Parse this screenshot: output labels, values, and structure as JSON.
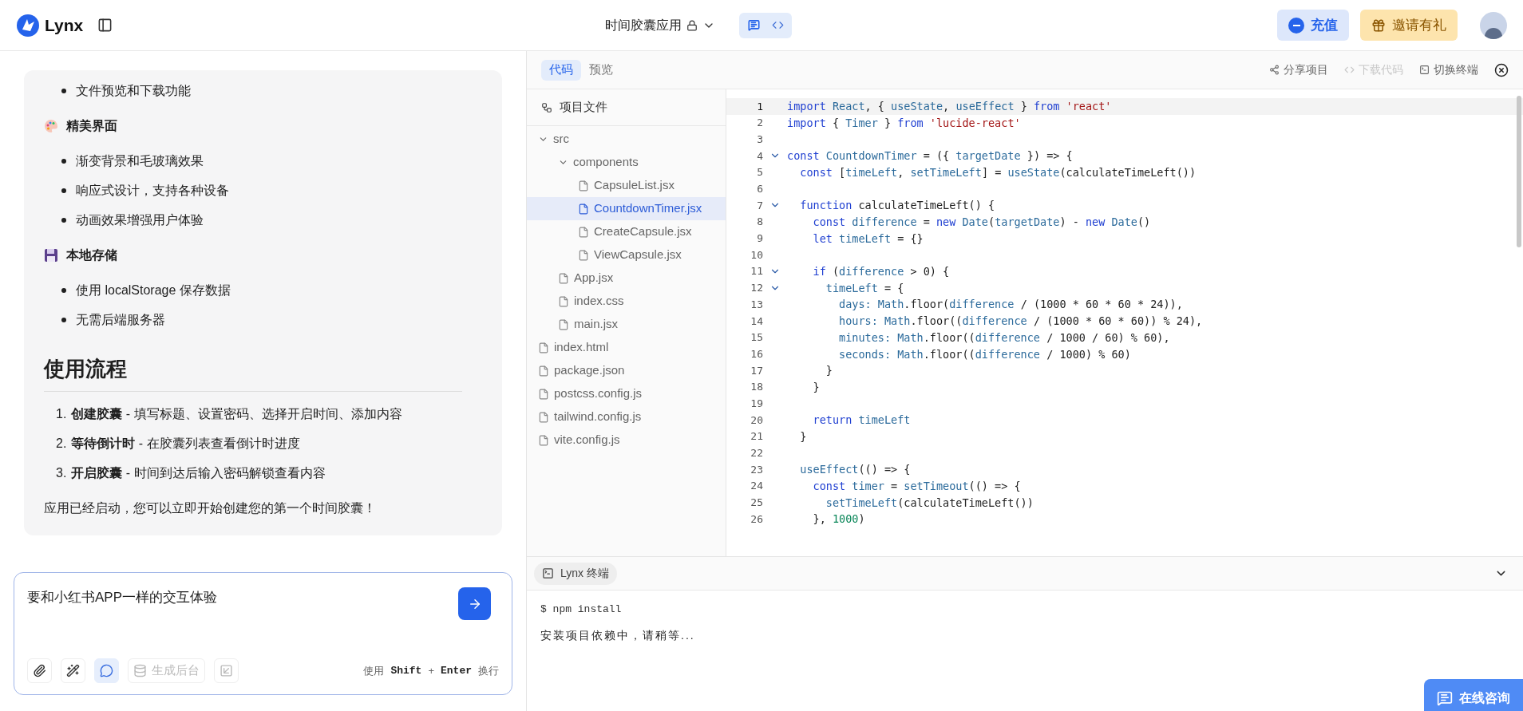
{
  "header": {
    "logo": "Lynx",
    "project_title": "时间胶囊应用",
    "view_modes": [
      {
        "selected": true
      },
      {
        "selected": false
      }
    ],
    "recharge": "充值",
    "invite": "邀请有礼"
  },
  "chat": [
    {
      "kind": "bullets",
      "items": [
        "文件预览和下载功能"
      ]
    },
    {
      "kind": "subheading",
      "text": "精美界面"
    },
    {
      "kind": "bullets",
      "items": [
        "渐变背景和毛玻璃效果",
        "响应式设计，支持各种设备",
        "动画效果增强用户体验"
      ]
    },
    {
      "kind": "subheading",
      "text": "本地存储"
    },
    {
      "kind": "bullets",
      "items": [
        "使用 localStorage 保存数据",
        "无需后端服务器"
      ]
    },
    {
      "kind": "heading",
      "text": "使用流程"
    },
    {
      "kind": "ordered",
      "items": [
        {
          "number": "1.",
          "text": "**创建胶囊** - 填写标题、设置密码、选择开启时间、添加内容"
        },
        {
          "number": "2.",
          "text": "**等待倒计时** - 在胶囊列表查看倒计时进度"
        },
        {
          "number": "3.",
          "text": "**开启胶囊** - 时间到达后输入密码解锁查看内容"
        }
      ]
    },
    {
      "kind": "paragraph",
      "text": "应用已经启动，您可以立即开始创建您的第一个时间胶囊！"
    }
  ],
  "composer": {
    "value": "要和小红书APP一样的交互体验",
    "tools": [
      {
        "selected": false,
        "disabled": false
      },
      {
        "selected": false,
        "disabled": false
      },
      {
        "selected": true,
        "disabled": false
      },
      {
        "label": "生成后台",
        "selected": false,
        "disabled": true
      },
      {
        "selected": false,
        "disabled": true
      }
    ],
    "hint": [
      "使用",
      "Shift",
      "+",
      "Enter",
      "换行"
    ]
  },
  "editor_tabs": [
    {
      "label": "代码",
      "selected": true
    },
    {
      "label": "预览",
      "selected": false
    }
  ],
  "editor_actions": [
    {
      "label": "分享项目",
      "disabled": false
    },
    {
      "label": "下载代码",
      "disabled": true
    },
    {
      "label": "切换终端",
      "disabled": false
    }
  ],
  "file_tree": {
    "title": "项目文件",
    "items": [
      {
        "name": "src",
        "kind": "folder",
        "expanded": true,
        "selected": false,
        "children": [
          {
            "name": "components",
            "kind": "folder",
            "expanded": true,
            "selected": false,
            "children": [
              {
                "name": "CapsuleList.jsx",
                "kind": "file",
                "selected": false
              },
              {
                "name": "CountdownTimer.jsx",
                "kind": "file",
                "selected": true
              },
              {
                "name": "CreateCapsule.jsx",
                "kind": "file",
                "selected": false
              },
              {
                "name": "ViewCapsule.jsx",
                "kind": "file",
                "selected": false
              }
            ]
          },
          {
            "name": "App.jsx",
            "kind": "file",
            "selected": false
          },
          {
            "name": "index.css",
            "kind": "file",
            "selected": false
          },
          {
            "name": "main.jsx",
            "kind": "file",
            "selected": false
          }
        ]
      },
      {
        "name": "index.html",
        "kind": "file",
        "selected": false
      },
      {
        "name": "package.json",
        "kind": "file",
        "selected": false
      },
      {
        "name": "postcss.config.js",
        "kind": "file",
        "selected": false
      },
      {
        "name": "tailwind.config.js",
        "kind": "file",
        "selected": false
      },
      {
        "name": "vite.config.js",
        "kind": "file",
        "selected": false
      }
    ]
  },
  "code": [
    {
      "n": "1",
      "fold": false,
      "current": true,
      "tokens": [
        {
          "kind": "kw",
          "text": "import"
        },
        {
          "kind": "id",
          "text": " React"
        },
        {
          "kind": "p",
          "text": ", { "
        },
        {
          "kind": "id",
          "text": "useState"
        },
        {
          "kind": "p",
          "text": ", "
        },
        {
          "kind": "id",
          "text": "useEffect"
        },
        {
          "kind": "p",
          "text": " } "
        },
        {
          "kind": "kw",
          "text": "from"
        },
        {
          "kind": "str",
          "text": " 'react'"
        }
      ]
    },
    {
      "n": "2",
      "fold": false,
      "current": false,
      "tokens": [
        {
          "kind": "kw",
          "text": "import"
        },
        {
          "kind": "p",
          "text": " { "
        },
        {
          "kind": "id",
          "text": "Timer"
        },
        {
          "kind": "p",
          "text": " } "
        },
        {
          "kind": "kw",
          "text": "from"
        },
        {
          "kind": "str",
          "text": " 'lucide-react'"
        }
      ]
    },
    {
      "n": "3",
      "fold": false,
      "current": false
    },
    {
      "n": "4",
      "fold": true,
      "current": false,
      "tokens": [
        {
          "kind": "kw",
          "text": "const"
        },
        {
          "kind": "id",
          "text": " CountdownTimer"
        },
        {
          "kind": "p",
          "text": " = ({ "
        },
        {
          "kind": "id",
          "text": "targetDate"
        },
        {
          "kind": "p",
          "text": " }) => {"
        }
      ]
    },
    {
      "n": "5",
      "fold": false,
      "current": false,
      "tokens": [
        {
          "kind": "kw",
          "text": "  const"
        },
        {
          "kind": "p",
          "text": " ["
        },
        {
          "kind": "id",
          "text": "timeLeft"
        },
        {
          "kind": "p",
          "text": ", "
        },
        {
          "kind": "id",
          "text": "setTimeLeft"
        },
        {
          "kind": "p",
          "text": "] = "
        },
        {
          "kind": "id",
          "text": "useState"
        },
        {
          "kind": "p",
          "text": "(calculateTimeLeft())"
        }
      ]
    },
    {
      "n": "6",
      "fold": false,
      "current": false
    },
    {
      "n": "7",
      "fold": true,
      "current": false,
      "tokens": [
        {
          "kind": "kw",
          "text": "  function"
        },
        {
          "kind": "p",
          "text": " calculateTimeLeft() {"
        }
      ]
    },
    {
      "n": "8",
      "fold": false,
      "current": false,
      "tokens": [
        {
          "kind": "kw",
          "text": "    const"
        },
        {
          "kind": "id",
          "text": " difference"
        },
        {
          "kind": "p",
          "text": " = "
        },
        {
          "kind": "kw",
          "text": "new"
        },
        {
          "kind": "id",
          "text": " Date"
        },
        {
          "kind": "p",
          "text": "("
        },
        {
          "kind": "id",
          "text": "targetDate"
        },
        {
          "kind": "p",
          "text": ") - "
        },
        {
          "kind": "kw",
          "text": "new"
        },
        {
          "kind": "id",
          "text": " Date"
        },
        {
          "kind": "p",
          "text": "()"
        }
      ]
    },
    {
      "n": "9",
      "fold": false,
      "current": false,
      "tokens": [
        {
          "kind": "kw",
          "text": "    let"
        },
        {
          "kind": "id",
          "text": " timeLeft"
        },
        {
          "kind": "p",
          "text": " = {}"
        }
      ]
    },
    {
      "n": "10",
      "fold": false,
      "current": false
    },
    {
      "n": "11",
      "fold": true,
      "current": false,
      "tokens": [
        {
          "kind": "kw",
          "text": "    if"
        },
        {
          "kind": "p",
          "text": " ("
        },
        {
          "kind": "id",
          "text": "difference"
        },
        {
          "kind": "p",
          "text": " > 0) {"
        }
      ]
    },
    {
      "n": "12",
      "fold": true,
      "current": false,
      "tokens": [
        {
          "kind": "id",
          "text": "      timeLeft"
        },
        {
          "kind": "p",
          "text": " = {"
        }
      ]
    },
    {
      "n": "13",
      "fold": false,
      "current": false,
      "tokens": [
        {
          "kind": "id",
          "text": "        days:"
        },
        {
          "kind": "id",
          "text": " Math"
        },
        {
          "kind": "p",
          "text": ".floor("
        },
        {
          "kind": "id",
          "text": "difference"
        },
        {
          "kind": "p",
          "text": " / (1000 * 60 * 60 * 24)),"
        }
      ]
    },
    {
      "n": "14",
      "fold": false,
      "current": false,
      "tokens": [
        {
          "kind": "id",
          "text": "        hours:"
        },
        {
          "kind": "id",
          "text": " Math"
        },
        {
          "kind": "p",
          "text": ".floor(("
        },
        {
          "kind": "id",
          "text": "difference"
        },
        {
          "kind": "p",
          "text": " / (1000 * 60 * 60)) % 24),"
        }
      ]
    },
    {
      "n": "15",
      "fold": false,
      "current": false,
      "tokens": [
        {
          "kind": "id",
          "text": "        minutes:"
        },
        {
          "kind": "id",
          "text": " Math"
        },
        {
          "kind": "p",
          "text": ".floor(("
        },
        {
          "kind": "id",
          "text": "difference"
        },
        {
          "kind": "p",
          "text": " / 1000 / 60) % 60),"
        }
      ]
    },
    {
      "n": "16",
      "fold": false,
      "current": false,
      "tokens": [
        {
          "kind": "id",
          "text": "        seconds:"
        },
        {
          "kind": "id",
          "text": " Math"
        },
        {
          "kind": "p",
          "text": ".floor(("
        },
        {
          "kind": "id",
          "text": "difference"
        },
        {
          "kind": "p",
          "text": " / 1000) % 60)"
        }
      ]
    },
    {
      "n": "17",
      "fold": false,
      "current": false,
      "tokens": [
        {
          "kind": "p",
          "text": "      }"
        }
      ]
    },
    {
      "n": "18",
      "fold": false,
      "current": false,
      "tokens": [
        {
          "kind": "p",
          "text": "    }"
        }
      ]
    },
    {
      "n": "19",
      "fold": false,
      "current": false
    },
    {
      "n": "20",
      "fold": false,
      "current": false,
      "tokens": [
        {
          "kind": "kw",
          "text": "    return"
        },
        {
          "kind": "id",
          "text": " timeLeft"
        }
      ]
    },
    {
      "n": "21",
      "fold": false,
      "current": false,
      "tokens": [
        {
          "kind": "p",
          "text": "  }"
        }
      ]
    },
    {
      "n": "22",
      "fold": false,
      "current": false
    },
    {
      "n": "23",
      "fold": false,
      "current": false,
      "tokens": [
        {
          "kind": "id",
          "text": "  useEffect"
        },
        {
          "kind": "p",
          "text": "(() => {"
        }
      ]
    },
    {
      "n": "24",
      "fold": false,
      "current": false,
      "tokens": [
        {
          "kind": "kw",
          "text": "    const"
        },
        {
          "kind": "id",
          "text": " timer"
        },
        {
          "kind": "p",
          "text": " = "
        },
        {
          "kind": "id",
          "text": "setTimeout"
        },
        {
          "kind": "p",
          "text": "(() => {"
        }
      ]
    },
    {
      "n": "25",
      "fold": false,
      "current": false,
      "tokens": [
        {
          "kind": "id",
          "text": "      setTimeLeft"
        },
        {
          "kind": "p",
          "text": "(calculateTimeLeft())"
        }
      ]
    },
    {
      "n": "26",
      "fold": false,
      "current": false,
      "tokens": [
        {
          "kind": "p",
          "text": "    }, "
        },
        {
          "kind": "num",
          "text": "1000"
        },
        {
          "kind": "p",
          "text": ")"
        }
      ]
    }
  ],
  "terminal": {
    "tab": "Lynx 终端",
    "lines": [
      {
        "kind": "command",
        "text": "$ npm install"
      },
      {
        "kind": "output",
        "text": "安装项目依赖中，请稍等..."
      }
    ]
  },
  "support_button": "在线咨询"
}
